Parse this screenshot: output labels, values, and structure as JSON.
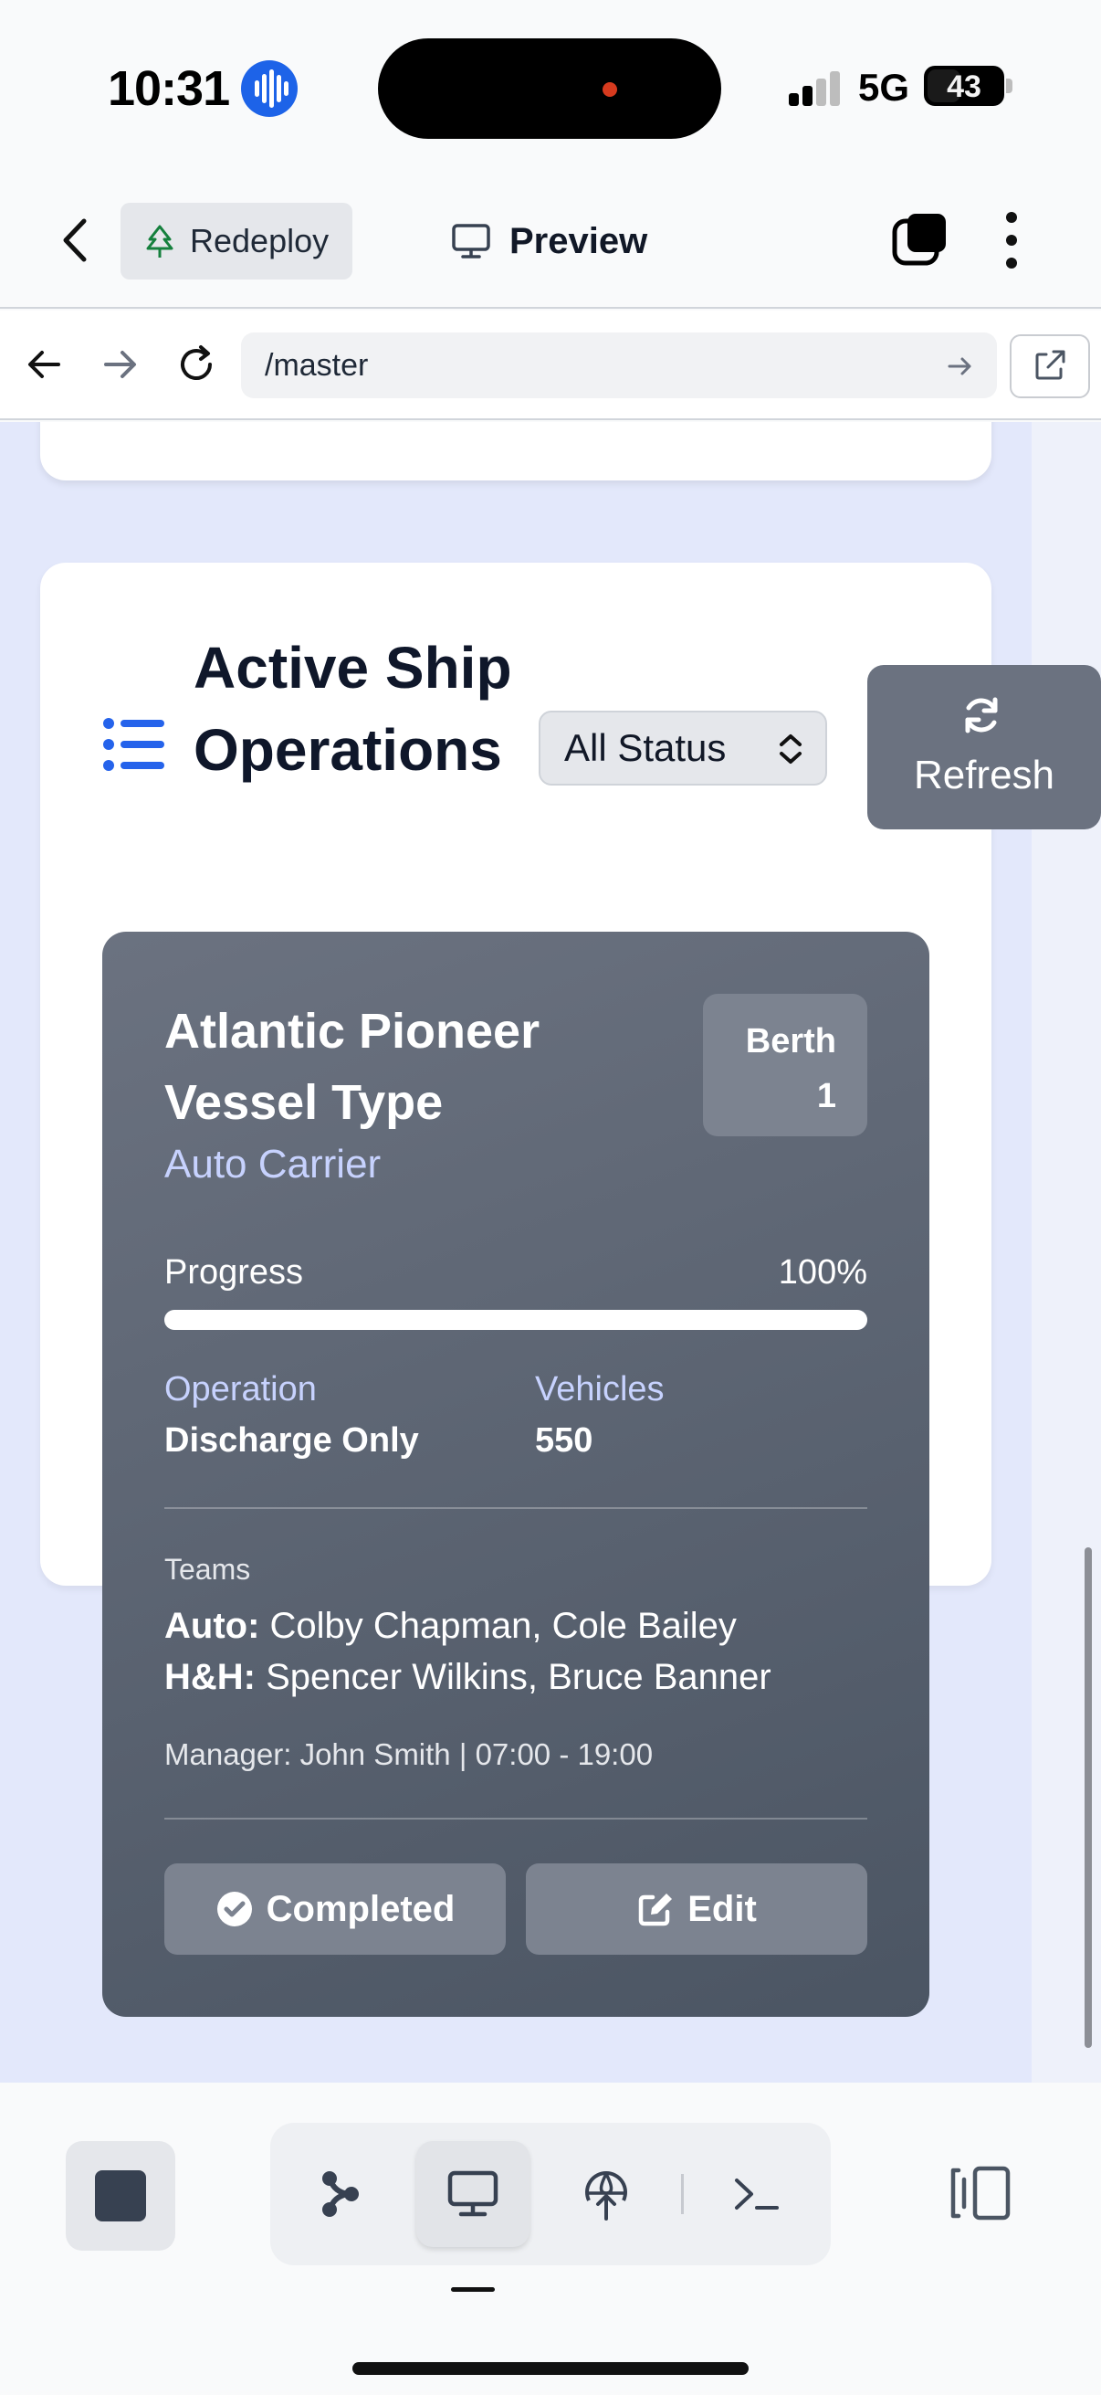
{
  "status_bar": {
    "time": "10:31",
    "network": "5G",
    "battery": "43",
    "icons": [
      "siri-waveform-icon",
      "signal-icon",
      "battery-icon"
    ]
  },
  "app_bar": {
    "redeploy_label": "Redeploy",
    "preview_label": "Preview",
    "icons": [
      "back-chevron-icon",
      "tree-icon",
      "monitor-icon",
      "tabs-icon",
      "more-vertical-icon"
    ]
  },
  "url_bar": {
    "path": "/master",
    "icons": [
      "back-arrow-icon",
      "forward-arrow-icon",
      "reload-icon",
      "go-arrow-icon",
      "external-link-icon"
    ]
  },
  "section": {
    "title": "Active Ship Operations",
    "filter_value": "All Status",
    "refresh_label": "Refresh"
  },
  "operation": {
    "ship_name": "Atlantic Pioneer Vessel Type",
    "vessel_type": "Auto Carrier",
    "berth_label": "Berth",
    "berth_number": "1",
    "progress_label": "Progress",
    "progress_text": "100%",
    "progress_fraction": 1.0,
    "operation_label": "Operation",
    "operation_value": "Discharge Only",
    "vehicles_label": "Vehicles",
    "vehicles_value": "550",
    "teams_label": "Teams",
    "teams": [
      {
        "name": "Auto:",
        "members": "Colby Chapman, Cole Bailey"
      },
      {
        "name": "H&H:",
        "members": "Spencer Wilkins, Bruce Banner"
      }
    ],
    "manager_line": "Manager: John Smith | 07:00 - 19:00",
    "status_button": "Completed",
    "edit_button": "Edit"
  },
  "bottom_toolbar": {
    "active_tool": "preview",
    "icons": [
      "stop-icon",
      "graph-icon",
      "monitor-icon",
      "deploy-icon",
      "terminal-icon",
      "panel-toggle-icon"
    ]
  },
  "colors": {
    "accent": "#1d63e8",
    "card_bg": "#5f6673",
    "page_bg": "#e3e8fb",
    "subtle_label": "#c7d2fe"
  }
}
